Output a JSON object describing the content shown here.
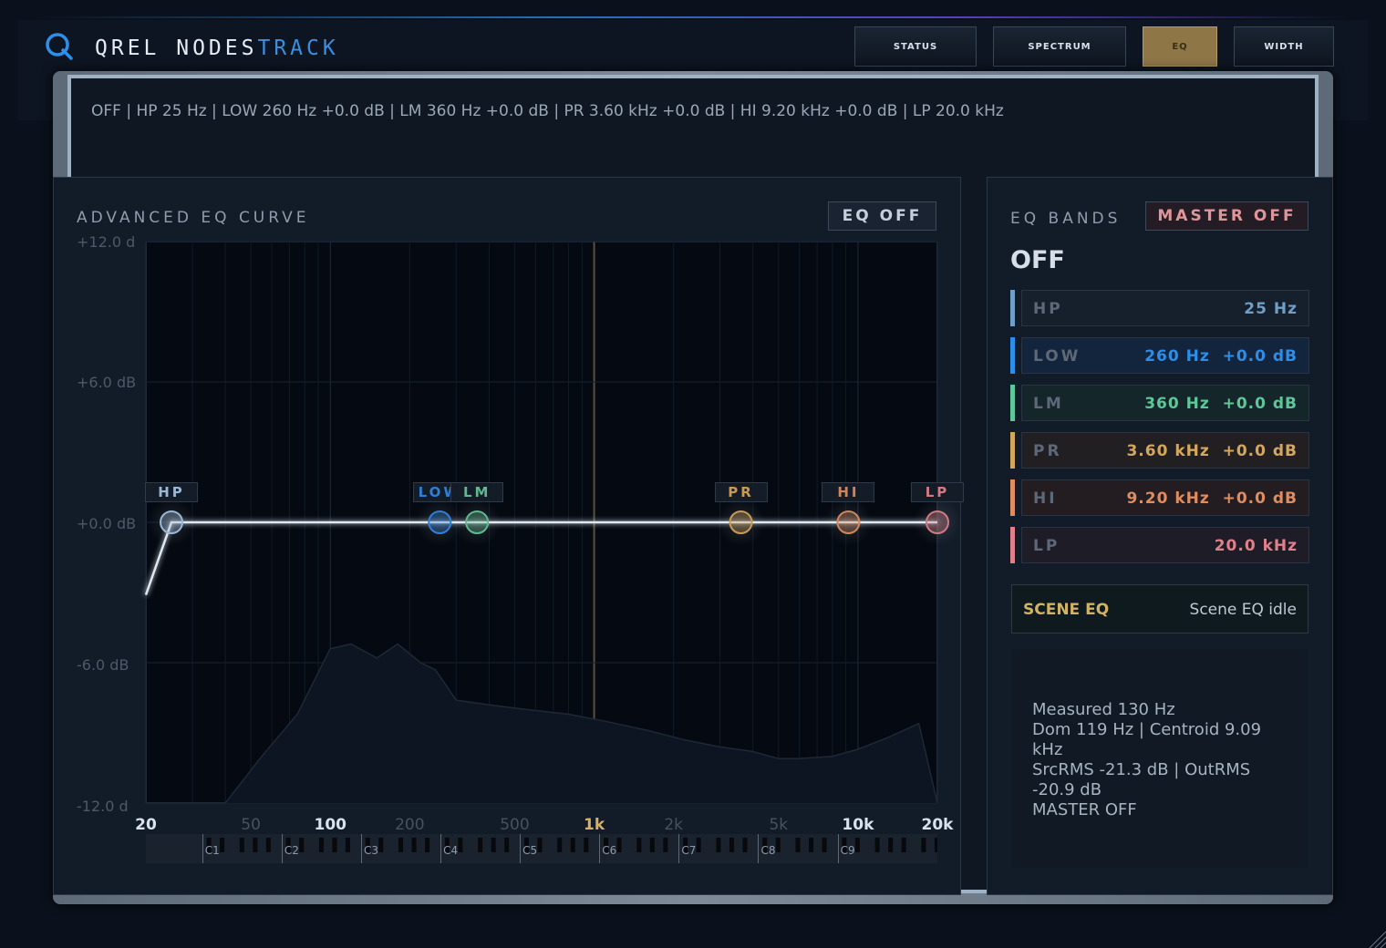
{
  "app": {
    "name_part1": "QREL NODES",
    "name_part2": "TRACK"
  },
  "tabs": [
    {
      "label": "STATUS",
      "active": false
    },
    {
      "label": "SPECTRUM",
      "active": false
    },
    {
      "label": "EQ",
      "active": true
    },
    {
      "label": "WIDTH",
      "active": false
    }
  ],
  "status_line": "OFF | HP 25 Hz | LOW 260 Hz +0.0 dB | LM 360 Hz +0.0 dB | PR 3.60 kHz +0.0 dB | HI 9.20 kHz +0.0 dB | LP 20.0 kHz",
  "curve_panel": {
    "title": "ADVANCED EQ CURVE",
    "eq_toggle_label": "EQ OFF",
    "y_labels": [
      "+12.0 d",
      "+6.0 dB",
      "+0.0 dB",
      "-6.0 dB",
      "-12.0 d"
    ],
    "x_labels": [
      {
        "text": "20",
        "style": "major"
      },
      {
        "text": "50",
        "style": "minor"
      },
      {
        "text": "100",
        "style": "major"
      },
      {
        "text": "200",
        "style": "minor"
      },
      {
        "text": "500",
        "style": "minor"
      },
      {
        "text": "1k",
        "style": "accent"
      },
      {
        "text": "2k",
        "style": "minor"
      },
      {
        "text": "5k",
        "style": "minor"
      },
      {
        "text": "10k",
        "style": "major"
      },
      {
        "text": "20k",
        "style": "major"
      }
    ],
    "octaves": [
      "C1",
      "C2",
      "C3",
      "C4",
      "C5",
      "C6",
      "C7",
      "C8",
      "C9"
    ],
    "nodes": [
      {
        "label": "HP",
        "freq_hz": 25,
        "gain_db": 0.0,
        "color": "#9ab8d6"
      },
      {
        "label": "LOW",
        "freq_hz": 260,
        "gain_db": 0.0,
        "color": "#2f7fd6"
      },
      {
        "label": "LM",
        "freq_hz": 360,
        "gain_db": 0.0,
        "color": "#5fb98f"
      },
      {
        "label": "PR",
        "freq_hz": 3600,
        "gain_db": 0.0,
        "color": "#c99a52"
      },
      {
        "label": "HI",
        "freq_hz": 9200,
        "gain_db": 0.0,
        "color": "#d0855a"
      },
      {
        "label": "LP",
        "freq_hz": 20000,
        "gain_db": 0.0,
        "color": "#d27a82"
      }
    ],
    "curve": {
      "x_hz": [
        20,
        25,
        20000
      ],
      "y_db": [
        -3.1,
        0.0,
        0.0
      ]
    },
    "spectrum": {
      "x_hz": [
        20,
        25,
        30,
        40,
        55,
        75,
        100,
        120,
        150,
        180,
        220,
        250,
        300,
        400,
        550,
        800,
        1100,
        1600,
        2200,
        3000,
        4000,
        5000,
        6000,
        8000,
        10000,
        13000,
        17000,
        20000
      ],
      "y_db": [
        -12,
        -12,
        -12,
        -12,
        -10,
        -8.2,
        -5.4,
        -5.2,
        -5.8,
        -5.2,
        -6.0,
        -6.3,
        -7.6,
        -7.8,
        -8.0,
        -8.2,
        -8.5,
        -8.9,
        -9.3,
        -9.6,
        -9.8,
        -10.1,
        -10.1,
        -10.0,
        -9.7,
        -9.2,
        -8.6,
        -12
      ]
    }
  },
  "bands_panel": {
    "title": "EQ BANDS",
    "master_label": "MASTER OFF",
    "state": "OFF",
    "bands": [
      {
        "name": "HP",
        "value": "25 Hz",
        "color": "#6f9fc9",
        "bg": "#161f2c"
      },
      {
        "name": "LOW",
        "value": "260 Hz  +0.0 dB",
        "color": "#2c8ee8",
        "bg": "#13253c"
      },
      {
        "name": "LM",
        "value": "360 Hz  +0.0 dB",
        "color": "#5ec79a",
        "bg": "#15262a"
      },
      {
        "name": "PR",
        "value": "3.60 kHz  +0.0 dB",
        "color": "#d5a75c",
        "bg": "#221f22"
      },
      {
        "name": "HI",
        "value": "9.20 kHz  +0.0 dB",
        "color": "#df8c5e",
        "bg": "#231d22"
      },
      {
        "name": "LP",
        "value": "20.0 kHz",
        "color": "#e0808a",
        "bg": "#1e1c26"
      }
    ],
    "scene_label": "SCENE EQ",
    "scene_status": "Scene EQ idle",
    "measure_lines": [
      "Measured 130 Hz",
      "Dom 119 Hz | Centroid 9.09",
      "kHz",
      "SrcRMS -21.3 dB | OutRMS",
      "-20.9 dB",
      "MASTER OFF"
    ]
  }
}
